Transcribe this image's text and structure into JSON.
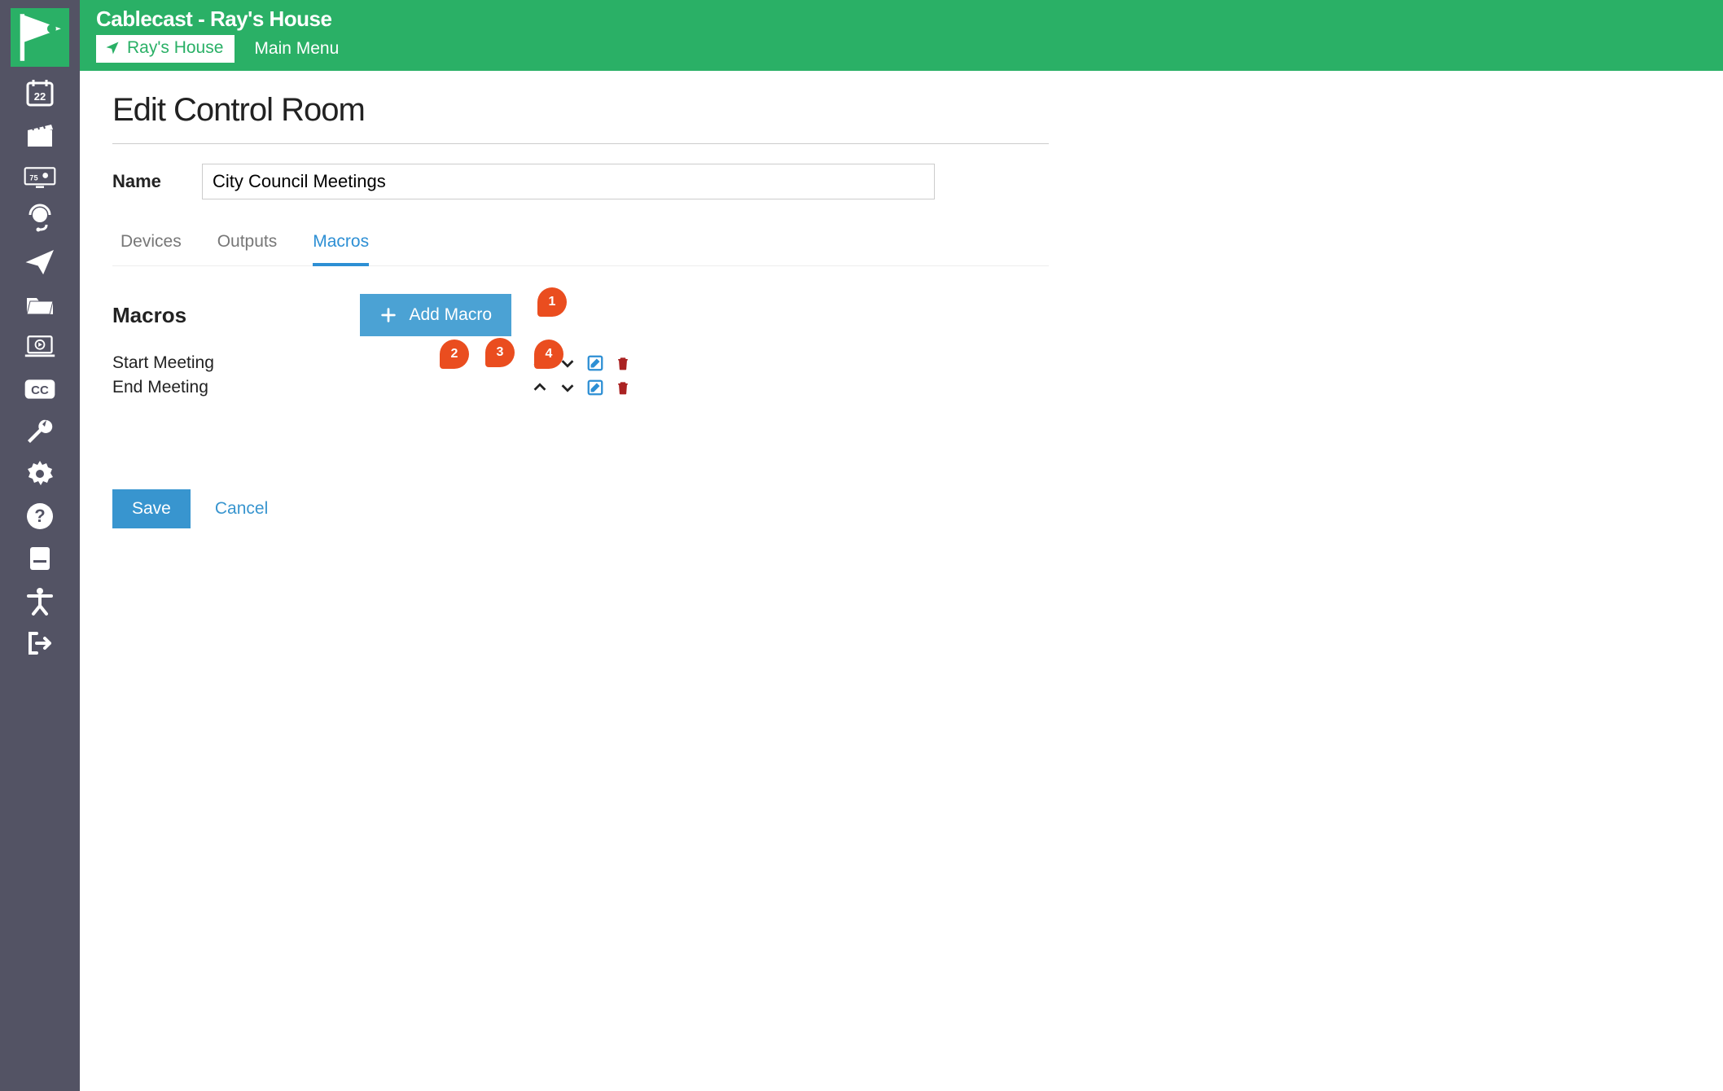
{
  "app": {
    "title": "Cablecast - Ray's House",
    "location_name": "Ray's House",
    "main_menu_label": "Main Menu"
  },
  "sidebar": {
    "calendar_badge": "22",
    "monitor_badge": "75"
  },
  "page": {
    "title": "Edit Control Room",
    "name_label": "Name",
    "name_value": "City Council Meetings"
  },
  "tabs": [
    {
      "label": "Devices",
      "active": false
    },
    {
      "label": "Outputs",
      "active": false
    },
    {
      "label": "Macros",
      "active": true
    }
  ],
  "macros": {
    "section_title": "Macros",
    "add_button_label": "Add Macro",
    "items": [
      {
        "name": "Start Meeting"
      },
      {
        "name": "End Meeting"
      }
    ]
  },
  "actions": {
    "save_label": "Save",
    "cancel_label": "Cancel"
  },
  "callouts": [
    {
      "num": "1"
    },
    {
      "num": "2"
    },
    {
      "num": "3"
    },
    {
      "num": "4"
    }
  ]
}
